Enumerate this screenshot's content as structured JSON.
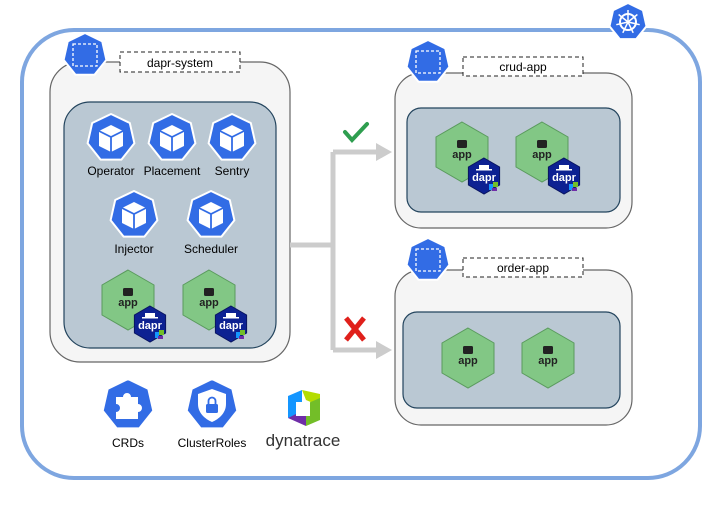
{
  "cluster": {
    "logo_icon": "kubernetes-helm-wheel-icon",
    "border_color": "#7ea6e0"
  },
  "dapr_system": {
    "namespace_label": "dapr-system",
    "services": [
      {
        "label": "Operator",
        "icon": "pod-cube-icon"
      },
      {
        "label": "Placement",
        "icon": "pod-cube-icon"
      },
      {
        "label": "Sentry",
        "icon": "pod-cube-icon"
      },
      {
        "label": "Injector",
        "icon": "pod-cube-icon"
      },
      {
        "label": "Scheduler",
        "icon": "pod-cube-icon"
      }
    ],
    "apps": [
      {
        "label": "app",
        "sidecar": "dapr"
      },
      {
        "label": "app",
        "sidecar": "dapr"
      }
    ]
  },
  "resources": [
    {
      "label": "CRDs",
      "icon": "puzzle-piece-icon"
    },
    {
      "label": "ClusterRoles",
      "icon": "shield-lock-icon"
    }
  ],
  "dynatrace": {
    "label": "dynatrace"
  },
  "crud_app": {
    "namespace_label": "crud-app",
    "status_icon": "checkmark-icon",
    "status_color": "#2e9e4f",
    "apps": [
      {
        "label": "app",
        "sidecar": "dapr"
      },
      {
        "label": "app",
        "sidecar": "dapr"
      }
    ]
  },
  "order_app": {
    "namespace_label": "order-app",
    "status_icon": "x-mark-icon",
    "status_color": "#e0201b",
    "apps": [
      {
        "label": "app"
      },
      {
        "label": "app"
      }
    ]
  },
  "colors": {
    "k8s_blue": "#326ce5",
    "app_green": "#82c785",
    "dapr_navy": "#0d2192",
    "arrow_gray": "#cccccc"
  }
}
